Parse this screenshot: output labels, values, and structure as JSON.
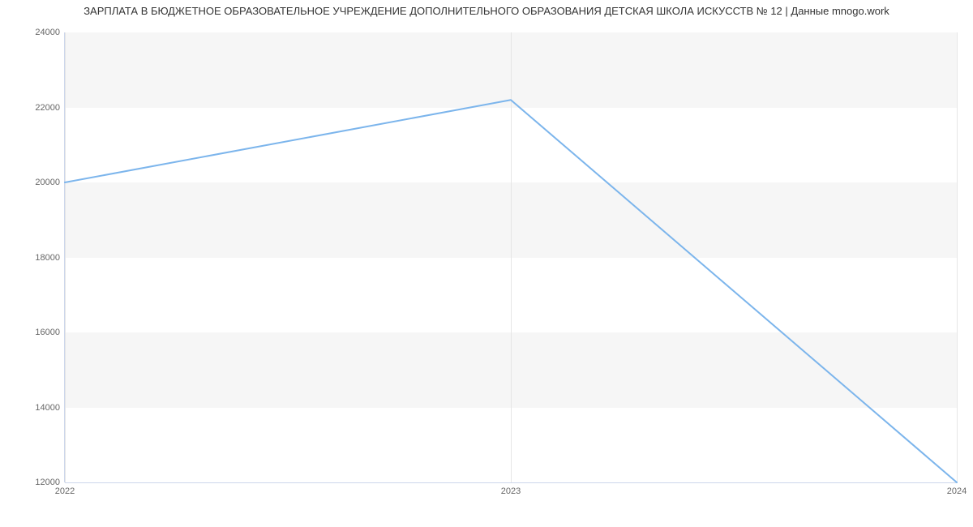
{
  "chart_data": {
    "type": "line",
    "title": "ЗАРПЛАТА В БЮДЖЕТНОЕ ОБРАЗОВАТЕЛЬНОЕ УЧРЕЖДЕНИЕ ДОПОЛНИТЕЛЬНОГО ОБРАЗОВАНИЯ ДЕТСКАЯ ШКОЛА ИСКУССТВ № 12 | Данные mnogo.work",
    "x": [
      2022,
      2023,
      2024
    ],
    "values": [
      20000,
      22200,
      12000
    ],
    "xlabel": "",
    "ylabel": "",
    "xlim": [
      2022,
      2024
    ],
    "ylim": [
      12000,
      24000
    ],
    "x_ticks": [
      "2022",
      "2023",
      "2024"
    ],
    "y_ticks": [
      "12000",
      "14000",
      "16000",
      "18000",
      "20000",
      "22000",
      "24000"
    ],
    "grid": true,
    "series_color": "#7cb5ec"
  }
}
